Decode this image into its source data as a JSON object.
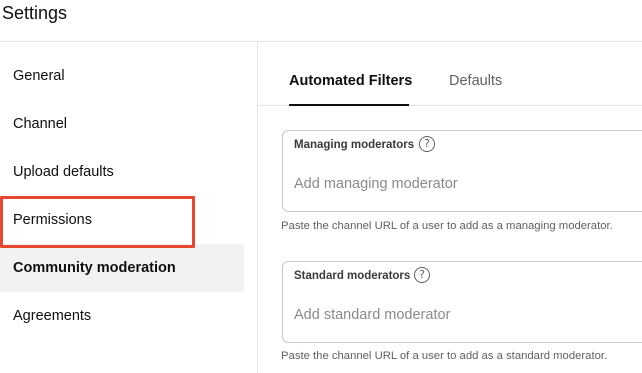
{
  "header": {
    "title": "Settings"
  },
  "sidebar": {
    "items": [
      {
        "label": "General"
      },
      {
        "label": "Channel"
      },
      {
        "label": "Upload defaults"
      },
      {
        "label": "Permissions"
      },
      {
        "label": "Community moderation",
        "active": true
      },
      {
        "label": "Agreements"
      }
    ]
  },
  "tabs": [
    {
      "label": "Automated Filters",
      "active": true
    },
    {
      "label": "Defaults"
    }
  ],
  "managing": {
    "label": "Managing moderators",
    "help_icon": "help-circle-icon",
    "placeholder": "Add managing moderator",
    "value": "",
    "hint": "Paste the channel URL of a user to add as a managing moderator."
  },
  "standard": {
    "label": "Standard moderators",
    "help_icon": "help-circle-icon",
    "placeholder": "Add standard moderator",
    "value": "",
    "hint": "Paste the channel URL of a user to add as a standard moderator."
  },
  "colors": {
    "highlight": "#e8472f",
    "active_bg": "#f2f2f2",
    "text": "#0f0f0f",
    "muted": "#606060"
  }
}
